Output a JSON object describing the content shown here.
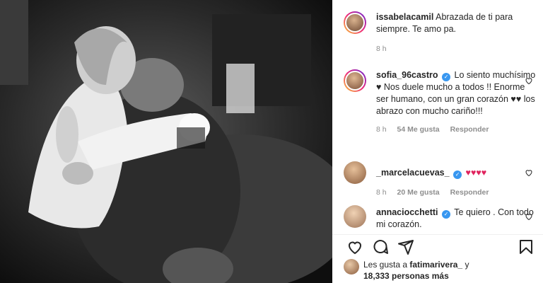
{
  "post": {
    "caption": {
      "username": "issabelacamil",
      "text": "Abrazada de ti para siempre. Te amo pa.",
      "time": "8 h"
    },
    "comments": [
      {
        "username": "sofia_96castro",
        "verified": true,
        "text": "Lo siento muchísimo ♥ Nos duele mucho a todos !! Enorme ser humano, con un gran corazón ♥♥ los abrazo con mucho cariño!!!",
        "time": "8 h",
        "likes": "54 Me gusta",
        "reply": "Responder"
      },
      {
        "username": "_marcelacuevas_",
        "verified": true,
        "text": "♥♥♥♥",
        "time": "8 h",
        "likes": "20 Me gusta",
        "reply": "Responder"
      },
      {
        "username": "annaciocchetti",
        "verified": true,
        "text": "Te quiero . Con todo mi corazón.",
        "time": "",
        "likes": "",
        "reply": ""
      }
    ],
    "liked_by": {
      "prefix": "Les gusta a",
      "user": "fatimarivera_",
      "connector": "y",
      "others": "18,333 personas más"
    }
  },
  "icons": {
    "like": "heart-icon",
    "comment": "comment-icon",
    "share": "share-icon",
    "save": "bookmark-icon",
    "comment_like": "small-heart-icon",
    "verified": "verified-badge-icon"
  },
  "colors": {
    "verified": "#3897f0",
    "meta": "#8e8e8e",
    "text": "#262626",
    "heart": "#e0245e"
  }
}
